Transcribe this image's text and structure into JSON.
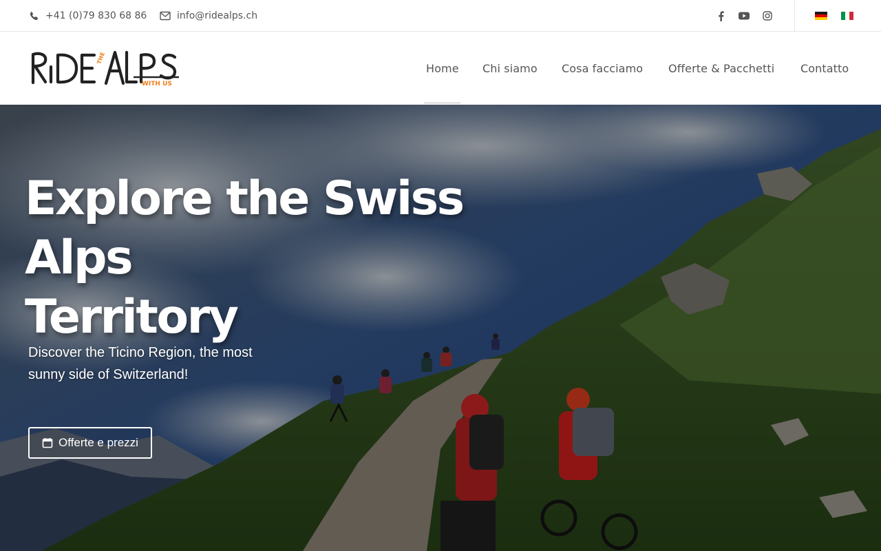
{
  "topbar": {
    "phone": "+41 (0)79 830 68 86",
    "email": "info@ridealps.ch",
    "icons": [
      "phone-icon",
      "envelope-icon",
      "facebook-icon",
      "youtube-icon",
      "instagram-icon"
    ],
    "languages": [
      "de",
      "it"
    ]
  },
  "logo": {
    "main_text": "RiDEALPS",
    "accent_top": "THE",
    "accent_bottom": "WITH US",
    "colors": {
      "main": "#222222",
      "accent": "#f07f1a"
    }
  },
  "nav": {
    "items": [
      {
        "label": "Home",
        "active": true
      },
      {
        "label": "Chi siamo"
      },
      {
        "label": "Cosa facciamo"
      },
      {
        "label": "Offerte & Pacchetti"
      },
      {
        "label": "Contatto"
      }
    ]
  },
  "hero": {
    "title_line1": "Explore the Swiss Alps",
    "title_line2": "Territory",
    "subtitle_line1": "Discover the Ticino Region, the most",
    "subtitle_line2": "sunny side of Switzerland!",
    "cta_label": "Offerte e prezzi",
    "cta_icon": "calendar-icon"
  }
}
